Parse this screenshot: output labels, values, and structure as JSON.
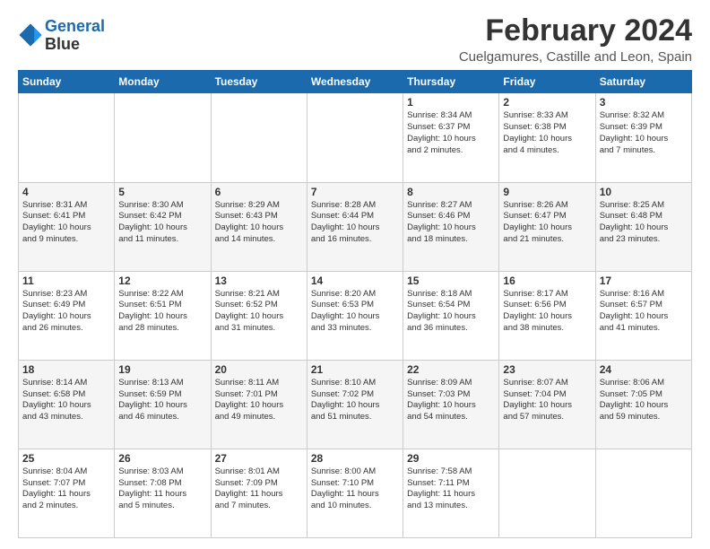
{
  "logo": {
    "line1": "General",
    "line2": "Blue"
  },
  "title": "February 2024",
  "subtitle": "Cuelgamures, Castille and Leon, Spain",
  "weekdays": [
    "Sunday",
    "Monday",
    "Tuesday",
    "Wednesday",
    "Thursday",
    "Friday",
    "Saturday"
  ],
  "weeks": [
    [
      {
        "day": "",
        "detail": ""
      },
      {
        "day": "",
        "detail": ""
      },
      {
        "day": "",
        "detail": ""
      },
      {
        "day": "",
        "detail": ""
      },
      {
        "day": "1",
        "detail": "Sunrise: 8:34 AM\nSunset: 6:37 PM\nDaylight: 10 hours\nand 2 minutes."
      },
      {
        "day": "2",
        "detail": "Sunrise: 8:33 AM\nSunset: 6:38 PM\nDaylight: 10 hours\nand 4 minutes."
      },
      {
        "day": "3",
        "detail": "Sunrise: 8:32 AM\nSunset: 6:39 PM\nDaylight: 10 hours\nand 7 minutes."
      }
    ],
    [
      {
        "day": "4",
        "detail": "Sunrise: 8:31 AM\nSunset: 6:41 PM\nDaylight: 10 hours\nand 9 minutes."
      },
      {
        "day": "5",
        "detail": "Sunrise: 8:30 AM\nSunset: 6:42 PM\nDaylight: 10 hours\nand 11 minutes."
      },
      {
        "day": "6",
        "detail": "Sunrise: 8:29 AM\nSunset: 6:43 PM\nDaylight: 10 hours\nand 14 minutes."
      },
      {
        "day": "7",
        "detail": "Sunrise: 8:28 AM\nSunset: 6:44 PM\nDaylight: 10 hours\nand 16 minutes."
      },
      {
        "day": "8",
        "detail": "Sunrise: 8:27 AM\nSunset: 6:46 PM\nDaylight: 10 hours\nand 18 minutes."
      },
      {
        "day": "9",
        "detail": "Sunrise: 8:26 AM\nSunset: 6:47 PM\nDaylight: 10 hours\nand 21 minutes."
      },
      {
        "day": "10",
        "detail": "Sunrise: 8:25 AM\nSunset: 6:48 PM\nDaylight: 10 hours\nand 23 minutes."
      }
    ],
    [
      {
        "day": "11",
        "detail": "Sunrise: 8:23 AM\nSunset: 6:49 PM\nDaylight: 10 hours\nand 26 minutes."
      },
      {
        "day": "12",
        "detail": "Sunrise: 8:22 AM\nSunset: 6:51 PM\nDaylight: 10 hours\nand 28 minutes."
      },
      {
        "day": "13",
        "detail": "Sunrise: 8:21 AM\nSunset: 6:52 PM\nDaylight: 10 hours\nand 31 minutes."
      },
      {
        "day": "14",
        "detail": "Sunrise: 8:20 AM\nSunset: 6:53 PM\nDaylight: 10 hours\nand 33 minutes."
      },
      {
        "day": "15",
        "detail": "Sunrise: 8:18 AM\nSunset: 6:54 PM\nDaylight: 10 hours\nand 36 minutes."
      },
      {
        "day": "16",
        "detail": "Sunrise: 8:17 AM\nSunset: 6:56 PM\nDaylight: 10 hours\nand 38 minutes."
      },
      {
        "day": "17",
        "detail": "Sunrise: 8:16 AM\nSunset: 6:57 PM\nDaylight: 10 hours\nand 41 minutes."
      }
    ],
    [
      {
        "day": "18",
        "detail": "Sunrise: 8:14 AM\nSunset: 6:58 PM\nDaylight: 10 hours\nand 43 minutes."
      },
      {
        "day": "19",
        "detail": "Sunrise: 8:13 AM\nSunset: 6:59 PM\nDaylight: 10 hours\nand 46 minutes."
      },
      {
        "day": "20",
        "detail": "Sunrise: 8:11 AM\nSunset: 7:01 PM\nDaylight: 10 hours\nand 49 minutes."
      },
      {
        "day": "21",
        "detail": "Sunrise: 8:10 AM\nSunset: 7:02 PM\nDaylight: 10 hours\nand 51 minutes."
      },
      {
        "day": "22",
        "detail": "Sunrise: 8:09 AM\nSunset: 7:03 PM\nDaylight: 10 hours\nand 54 minutes."
      },
      {
        "day": "23",
        "detail": "Sunrise: 8:07 AM\nSunset: 7:04 PM\nDaylight: 10 hours\nand 57 minutes."
      },
      {
        "day": "24",
        "detail": "Sunrise: 8:06 AM\nSunset: 7:05 PM\nDaylight: 10 hours\nand 59 minutes."
      }
    ],
    [
      {
        "day": "25",
        "detail": "Sunrise: 8:04 AM\nSunset: 7:07 PM\nDaylight: 11 hours\nand 2 minutes."
      },
      {
        "day": "26",
        "detail": "Sunrise: 8:03 AM\nSunset: 7:08 PM\nDaylight: 11 hours\nand 5 minutes."
      },
      {
        "day": "27",
        "detail": "Sunrise: 8:01 AM\nSunset: 7:09 PM\nDaylight: 11 hours\nand 7 minutes."
      },
      {
        "day": "28",
        "detail": "Sunrise: 8:00 AM\nSunset: 7:10 PM\nDaylight: 11 hours\nand 10 minutes."
      },
      {
        "day": "29",
        "detail": "Sunrise: 7:58 AM\nSunset: 7:11 PM\nDaylight: 11 hours\nand 13 minutes."
      },
      {
        "day": "",
        "detail": ""
      },
      {
        "day": "",
        "detail": ""
      }
    ]
  ]
}
